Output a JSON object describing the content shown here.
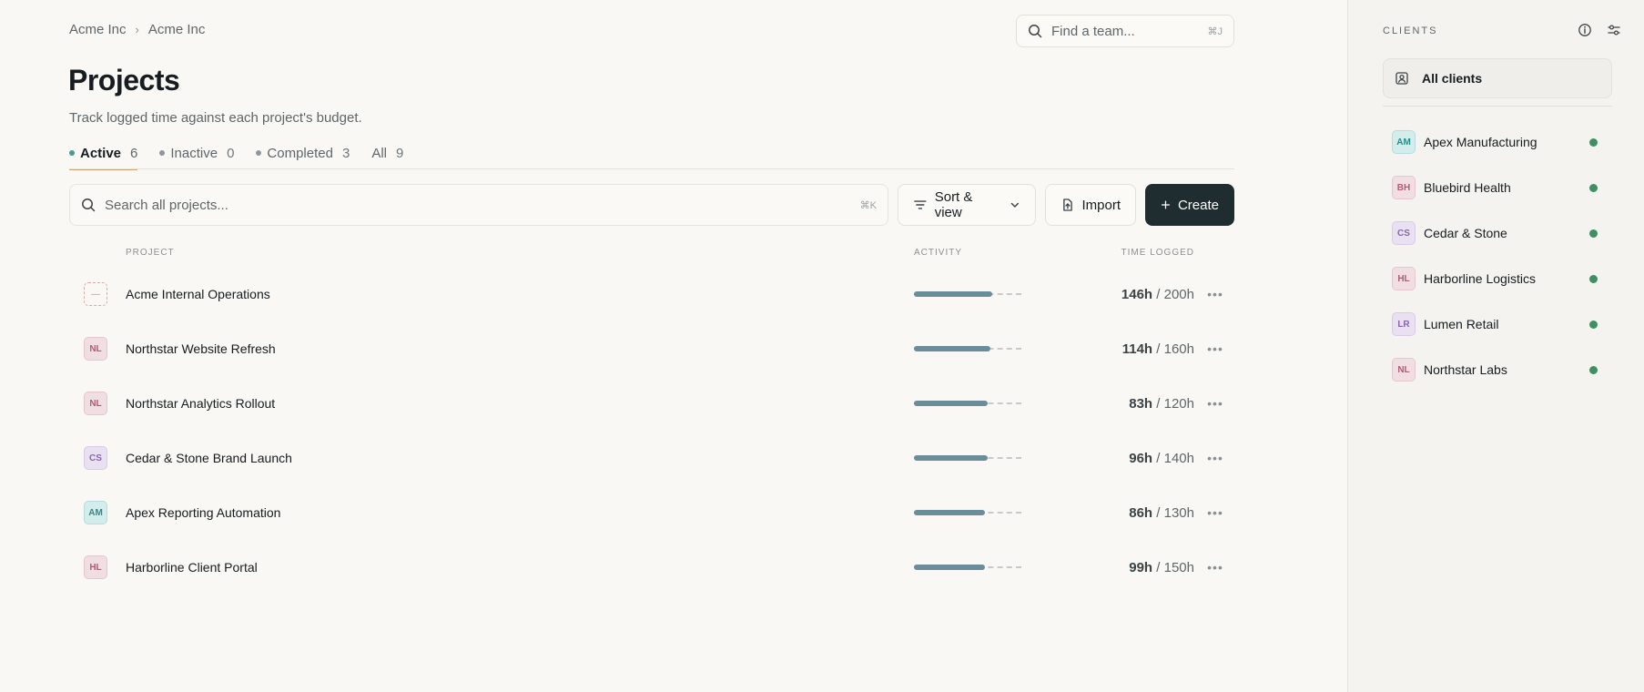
{
  "breadcrumb": [
    "Acme Inc",
    "Acme Inc"
  ],
  "team_search": {
    "placeholder": "Find a team...",
    "shortcut": "⌘J"
  },
  "page": {
    "title": "Projects",
    "subtitle": "Track logged time against each project's budget."
  },
  "tabs": [
    {
      "label": "Active",
      "count": "6",
      "dot": true
    },
    {
      "label": "Inactive",
      "count": "0",
      "dot": true
    },
    {
      "label": "Completed",
      "count": "3",
      "dot": true
    },
    {
      "label": "All",
      "count": "9",
      "dot": false
    }
  ],
  "toolbar": {
    "search_placeholder": "Search all projects...",
    "search_shortcut": "⌘K",
    "sort_label": "Sort & view",
    "import_label": "Import",
    "create_label": "Create"
  },
  "table": {
    "headers": {
      "project": "PROJECT",
      "activity": "ACTIVITY",
      "time": "TIME LOGGED"
    },
    "rows": [
      {
        "badge": "—",
        "badge_style": "empty",
        "name": "Acme Internal Operations",
        "logged": "146h",
        "budget": "/ 200h",
        "progress": 0.73
      },
      {
        "badge": "NL",
        "badge_style": "pink",
        "name": "Northstar Website Refresh",
        "logged": "114h",
        "budget": "/ 160h",
        "progress": 0.71
      },
      {
        "badge": "NL",
        "badge_style": "pink",
        "name": "Northstar Analytics Rollout",
        "logged": "83h",
        "budget": "/ 120h",
        "progress": 0.69
      },
      {
        "badge": "CS",
        "badge_style": "lavender",
        "name": "Cedar & Stone Brand Launch",
        "logged": "96h",
        "budget": "/ 140h",
        "progress": 0.69
      },
      {
        "badge": "AM",
        "badge_style": "teal",
        "name": "Apex Reporting Automation",
        "logged": "86h",
        "budget": "/ 130h",
        "progress": 0.66
      },
      {
        "badge": "HL",
        "badge_style": "pink",
        "name": "Harborline Client Portal",
        "logged": "99h",
        "budget": "/ 150h",
        "progress": 0.66
      }
    ]
  },
  "sidebar": {
    "header": "CLIENTS",
    "all_clients_label": "All clients",
    "clients": [
      {
        "badge": "AM",
        "badge_style": "teal",
        "name": "Apex Manufacturing"
      },
      {
        "badge": "BH",
        "badge_style": "pink",
        "name": "Bluebird Health"
      },
      {
        "badge": "CS",
        "badge_style": "lavender",
        "name": "Cedar & Stone"
      },
      {
        "badge": "HL",
        "badge_style": "pink",
        "name": "Harborline Logistics"
      },
      {
        "badge": "LR",
        "badge_style": "lavender",
        "name": "Lumen Retail"
      },
      {
        "badge": "NL",
        "badge_style": "pink",
        "name": "Northstar Labs"
      }
    ]
  },
  "colors": {
    "accent_dark": "#1f2d30",
    "progress": "#6b8d99",
    "status_active": "#3f8f63",
    "tab_underline": "#c9a57a"
  }
}
